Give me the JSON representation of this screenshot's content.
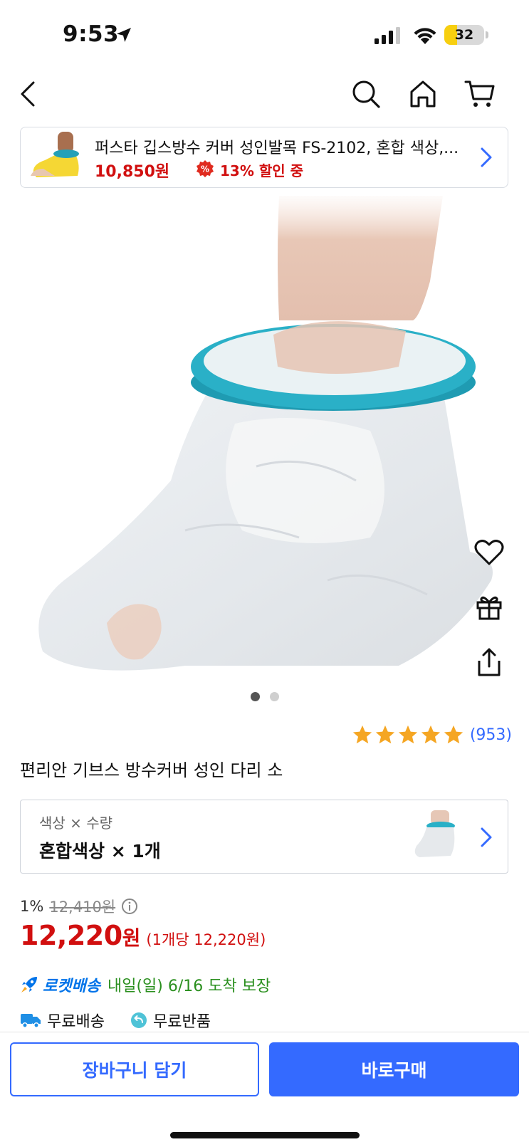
{
  "status_bar": {
    "time": "9:53",
    "battery": "32",
    "battery_level": 0.32,
    "battery_color": "#f7cf10"
  },
  "nav": {
    "icons": [
      "back-icon",
      "search-icon",
      "home-icon",
      "cart-icon"
    ]
  },
  "summary": {
    "title": "퍼스타 깁스방수 커버 성인발목 FS-2102, 혼합 색상,...",
    "price": "10,850원",
    "discount": "13% 할인 중"
  },
  "gallery": {
    "total_images": 2,
    "active_index": 0,
    "side_actions": [
      "heart-icon",
      "gift-icon",
      "share-icon"
    ]
  },
  "rating": {
    "stars": 5,
    "count": "(953)",
    "star_color": "#f5a623"
  },
  "product": {
    "title": "편리안 기브스 방수커버 성인 다리 소"
  },
  "option": {
    "label": "색상 × 수량",
    "value": "혼합색상 × 1개"
  },
  "price": {
    "discount_rate": "1%",
    "original": "12,410원",
    "final": "12,220",
    "currency": "원",
    "unit_price": "(1개당 12,220원)",
    "accent_color": "#d10f0f"
  },
  "delivery": {
    "rocket_label": "로켓배송",
    "text": "내일(일) 6/16 도착 보장"
  },
  "perks": {
    "free_shipping": "무료배송",
    "free_return": "무료반품"
  },
  "actions": {
    "cart": "장바구니 담기",
    "buy": "바로구매",
    "brand_color": "#346aff"
  }
}
